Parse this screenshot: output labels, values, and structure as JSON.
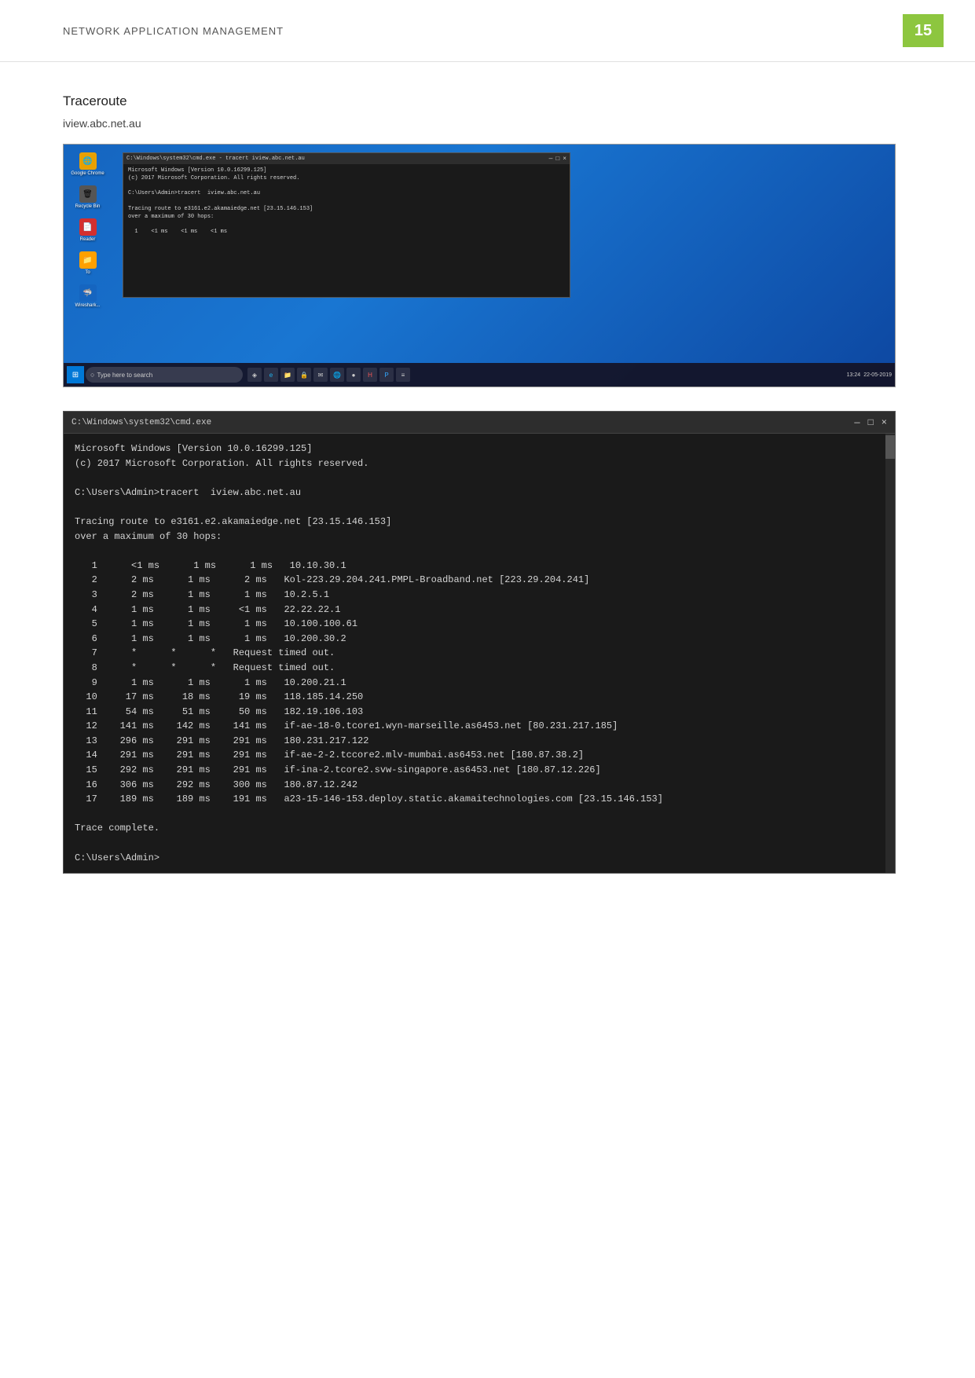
{
  "header": {
    "title": "NETWORK APPLICATION MANAGEMENT",
    "page_number": "15"
  },
  "section": {
    "heading": "Traceroute",
    "subheading": "iview.abc.net.au"
  },
  "screenshot": {
    "taskbar": {
      "search_placeholder": "Type here to search",
      "time": "13:24",
      "date": "22-05-2019"
    },
    "cmd_window": {
      "title": "C:\\Windows\\system32\\cmd.exe - tracert  iview.abc.net.au",
      "lines": [
        "Microsoft Windows [Version 10.0.16299.125]",
        "(c) 2017 Microsoft Corporation. All rights reserved.",
        "",
        "C:\\Users\\Admin>tracert  iview.abc.net.au",
        "",
        "Tracing route to e3161.e2.akamaiedge.net [23.15.146.153]",
        "over a maximum of 30 hops:",
        "",
        "  1    <1 ms    <1 ms    <1 ms"
      ]
    }
  },
  "terminal": {
    "title": "C:\\Windows\\system32\\cmd.exe",
    "lines": [
      "Microsoft Windows [Version 10.0.16299.125]",
      "(c) 2017 Microsoft Corporation. All rights reserved.",
      "",
      "C:\\Users\\Admin>tracert  iview.abc.net.au",
      "",
      "Tracing route to e3161.e2.akamaiedge.net [23.15.146.153]",
      "over a maximum of 30 hops:"
    ],
    "hops": [
      {
        "num": " 1",
        "t1": "  <1 ms",
        "t2": "   1 ms",
        "t3": "   1 ms",
        "addr": "10.10.30.1"
      },
      {
        "num": " 2",
        "t1": "  2 ms",
        "t2": "   1 ms",
        "t3": "   2 ms",
        "addr": "Kol-223.29.204.241.PMPL-Broadband.net [223.29.204.241]"
      },
      {
        "num": " 3",
        "t1": "  2 ms",
        "t2": "   1 ms",
        "t3": "   1 ms",
        "addr": "10.2.5.1"
      },
      {
        "num": " 4",
        "t1": "  1 ms",
        "t2": "   1 ms",
        "t3": "  <1 ms",
        "addr": "22.22.22.1"
      },
      {
        "num": " 5",
        "t1": "  1 ms",
        "t2": "   1 ms",
        "t3": "   1 ms",
        "addr": "10.100.100.61"
      },
      {
        "num": " 6",
        "t1": "  1 ms",
        "t2": "   1 ms",
        "t3": "   1 ms",
        "addr": "10.200.30.2"
      },
      {
        "num": " 7",
        "t1": "  *",
        "t2": "   *",
        "t3": "   *",
        "addr": "Request timed out."
      },
      {
        "num": " 8",
        "t1": "  *",
        "t2": "   *",
        "t3": "   *",
        "addr": "Request timed out."
      },
      {
        "num": " 9",
        "t1": "  1 ms",
        "t2": "   1 ms",
        "t3": "   1 ms",
        "addr": "10.200.21.1"
      },
      {
        "num": "10",
        "t1": " 17 ms",
        "t2": "  18 ms",
        "t3": "  19 ms",
        "addr": "118.185.14.250"
      },
      {
        "num": "11",
        "t1": " 54 ms",
        "t2": "  51 ms",
        "t3": "  50 ms",
        "addr": "182.19.106.103"
      },
      {
        "num": "12",
        "t1": "141 ms",
        "t2": " 142 ms",
        "t3": " 141 ms",
        "addr": "if-ae-18-0.tcore1.wyn-marseille.as6453.net [80.231.217.185]"
      },
      {
        "num": "13",
        "t1": "296 ms",
        "t2": " 291 ms",
        "t3": " 291 ms",
        "addr": "180.231.217.122"
      },
      {
        "num": "14",
        "t1": "291 ms",
        "t2": " 291 ms",
        "t3": " 291 ms",
        "addr": "if-ae-2-2.tccore2.mlv-mumbai.as6453.net [180.87.38.2]"
      },
      {
        "num": "15",
        "t1": "292 ms",
        "t2": " 291 ms",
        "t3": " 291 ms",
        "addr": "if-ina-2.tcore2.svw-singapore.as6453.net [180.87.12.226]"
      },
      {
        "num": "16",
        "t1": "306 ms",
        "t2": " 292 ms",
        "t3": " 300 ms",
        "addr": "180.87.12.242"
      },
      {
        "num": "17",
        "t1": "189 ms",
        "t2": " 189 ms",
        "t3": " 191 ms",
        "addr": "a23-15-146-153.deploy.static.akamaitechnologies.com [23.15.146.153]"
      }
    ],
    "footer_lines": [
      "",
      "Trace complete.",
      "",
      "C:\\Users\\Admin>"
    ]
  },
  "controls": {
    "minimize": "—",
    "maximize": "□",
    "close": "×"
  }
}
